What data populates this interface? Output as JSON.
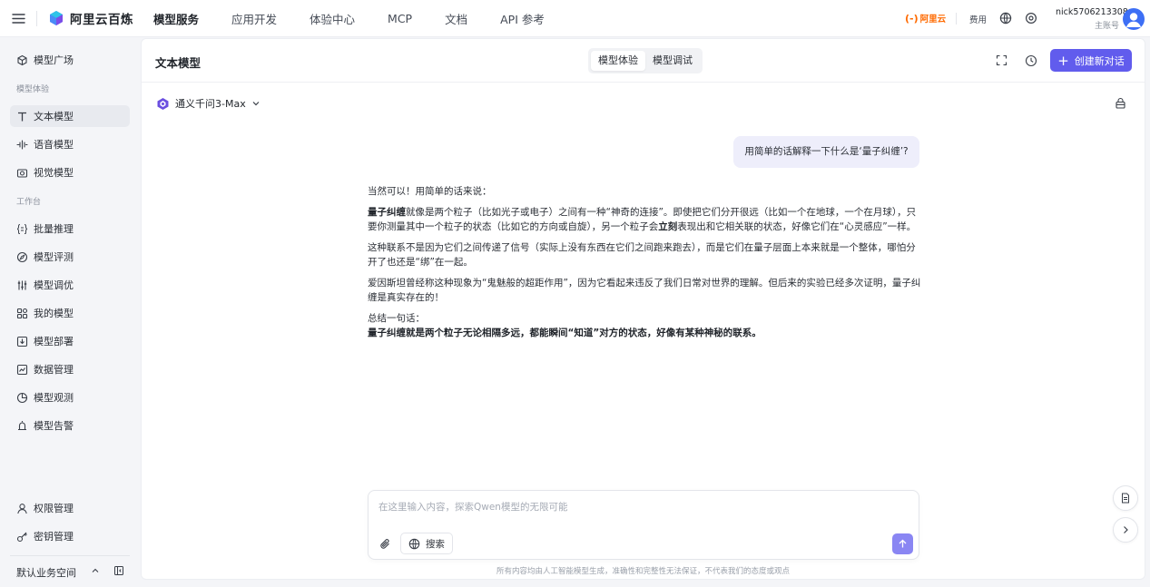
{
  "colors": {
    "accent": "#615ced",
    "send": "#8a86f3",
    "brand_orange": "#ff6a00",
    "avatar": "#3d6ff5"
  },
  "header": {
    "brand": "阿里云百炼",
    "nav": [
      "模型服务",
      "应用开发",
      "体验中心",
      "MCP",
      "文档",
      "API 参考"
    ],
    "aliyun_logo": "阿里云",
    "fee": "费用",
    "user_name": "nick5706213308",
    "user_role": "主账号"
  },
  "sidebar": {
    "top_item": "模型广场",
    "group_experience": "模型体验",
    "experience_items": [
      "文本模型",
      "语音模型",
      "视觉模型"
    ],
    "group_workbench": "工作台",
    "workbench_items": [
      "批量推理",
      "模型评测",
      "模型调优",
      "我的模型",
      "模型部署",
      "数据管理",
      "模型观测",
      "模型告警"
    ],
    "bottom_items": [
      "权限管理",
      "密钥管理"
    ],
    "workspace": "默认业务空间"
  },
  "panel": {
    "title": "文本模型",
    "tabs": [
      "模型体验",
      "模型调试"
    ],
    "new_chat": "创建新对话",
    "model_name": "通义千问3-Max"
  },
  "chat": {
    "user_message": "用简单的话解释一下什么是‘量子纠缠’?",
    "answer": {
      "intro": "当然可以！用简单的话来说：",
      "p1_bold": "量子纠缠",
      "p1_a": "就像是两个粒子（比如光子或电子）之间有一种“神奇的连接”。即使把它们分开很远（比如一个在地球，一个在月球），只要你测量其中一个粒子的状态（比如它的方向或自旋），另一个粒子会",
      "p1_bold2": "立刻",
      "p1_b": "表现出和它相关联的状态，好像它们在“心灵感应”一样。",
      "p2": "这种联系不是因为它们之间传递了信号（实际上没有东西在它们之间跑来跑去），而是它们在量子层面上本来就是一个整体，哪怕分开了也还是“绑”在一起。",
      "p3": "爱因斯坦曾经称这种现象为“鬼魅般的超距作用”，因为它看起来违反了我们日常对世界的理解。但后来的实验已经多次证明，量子纠缠是真实存在的！",
      "summary_label": "总结一句话：",
      "summary": "量子纠缠就是两个粒子无论相隔多远，都能瞬间“知道”对方的状态，好像有某种神秘的联系。"
    }
  },
  "input": {
    "placeholder": "在这里输入内容，探索Qwen模型的无限可能",
    "value": "",
    "search_label": "搜索"
  },
  "disclaimer": "所有内容均由人工智能模型生成，准确性和完整性无法保证，不代表我们的态度或观点"
}
